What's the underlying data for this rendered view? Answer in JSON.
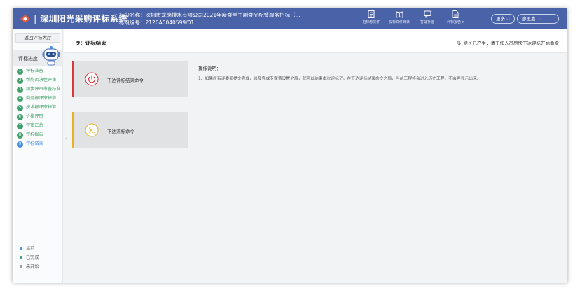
{
  "header": {
    "app_title": "深圳阳光采购评标系统",
    "project_name_label": "标段名称：",
    "project_name": "深圳市龙岗排水有限公司2021年度食堂主副食品配餐服务招标（...",
    "project_code_label": "标段编号：",
    "project_code": "2120A0040599/01",
    "tools": [
      {
        "label": "招标标文件",
        "icon": "document-icon"
      },
      {
        "label": "投标文件目录",
        "icon": "book-icon"
      },
      {
        "label": "答疑补遗",
        "icon": "chat-icon"
      },
      {
        "label": "评标报告",
        "icon": "report-icon"
      }
    ],
    "more_label": "更多",
    "user_label": "廖思嘉"
  },
  "sidebar": {
    "back_label": "返回评标大厅",
    "progress_label": "评标进度",
    "steps": [
      {
        "num": "1",
        "label": "评标准备",
        "state": "done"
      },
      {
        "num": "2",
        "label": "帮能否决性评审",
        "state": "done"
      },
      {
        "num": "3",
        "label": "初步评审审查标准",
        "state": "done"
      },
      {
        "num": "4",
        "label": "商务标评审标准",
        "state": "done"
      },
      {
        "num": "5",
        "label": "技术标评审标准",
        "state": "done"
      },
      {
        "num": "6",
        "label": "价格评审",
        "state": "done"
      },
      {
        "num": "7",
        "label": "评审汇总",
        "state": "done"
      },
      {
        "num": "8",
        "label": "评标报告",
        "state": "done"
      },
      {
        "num": "9",
        "label": "评标结束",
        "state": "current"
      }
    ],
    "legend": [
      {
        "label": "当前",
        "color": "#4a90e2"
      },
      {
        "label": "已完成",
        "color": "#3fa06a"
      },
      {
        "label": "未开始",
        "color": "#9a9a9a"
      }
    ]
  },
  "main": {
    "title": "9：评标结束",
    "notice": "组长已产生，请工作人员尽快下达评标开始命令",
    "cards": [
      {
        "label": "下达评标结束命令",
        "accent": "#d9363e",
        "icon": "power-icon"
      },
      {
        "label": "下达流标命令",
        "accent": "#e6b422",
        "icon": "terminal-icon"
      }
    ],
    "instructions_title": "操作说明：",
    "instructions_text": "1、如果所有评委都提交完成，以及完成专家费设置之后，就可以结束本次评标了。在下达评标结束命令之后，当前工程将会进入历史工程，不会再显示出来。"
  },
  "colors": {
    "header_bg": "#4a63a8",
    "done": "#3fa06a",
    "current": "#4a90e2"
  }
}
